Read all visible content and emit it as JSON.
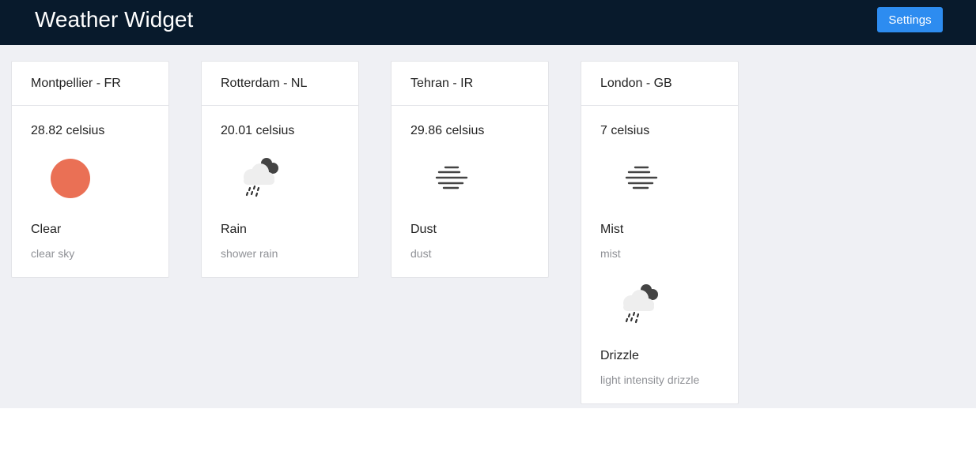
{
  "header": {
    "title": "Weather Widget",
    "settings_label": "Settings"
  },
  "colors": {
    "header_bg": "#081a2c",
    "accent": "#2d8cf0",
    "page_bg": "#eff0f4",
    "sun": "#ea7055"
  },
  "cities": [
    {
      "name": "Montpellier - FR",
      "temperature": "28.82 celsius",
      "weather": [
        {
          "main": "Clear",
          "description": "clear sky",
          "icon": "sun-icon"
        }
      ]
    },
    {
      "name": "Rotterdam - NL",
      "temperature": "20.01 celsius",
      "weather": [
        {
          "main": "Rain",
          "description": "shower rain",
          "icon": "rain-cloud-icon"
        }
      ]
    },
    {
      "name": "Tehran - IR",
      "temperature": "29.86 celsius",
      "weather": [
        {
          "main": "Dust",
          "description": "dust",
          "icon": "haze-icon"
        }
      ]
    },
    {
      "name": "London - GB",
      "temperature": "7 celsius",
      "weather": [
        {
          "main": "Mist",
          "description": "mist",
          "icon": "haze-icon"
        },
        {
          "main": "Drizzle",
          "description": "light intensity drizzle",
          "icon": "rain-cloud-icon"
        }
      ]
    }
  ]
}
